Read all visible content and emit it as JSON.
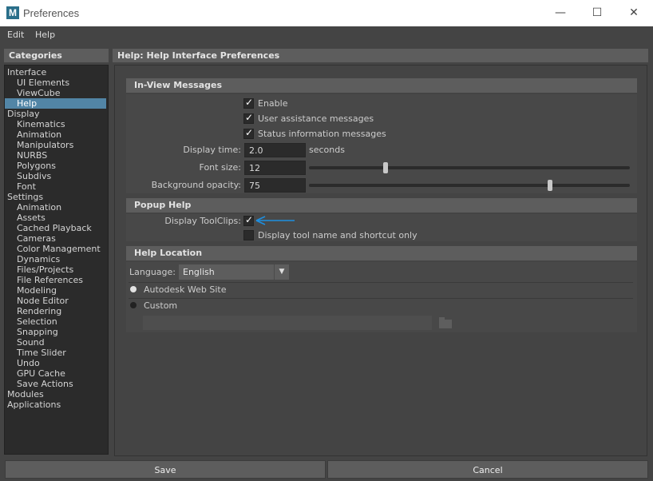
{
  "window": {
    "title": "Preferences",
    "app_icon_letter": "M",
    "minimize_glyph": "—",
    "maximize_glyph": "☐",
    "close_glyph": "✕"
  },
  "menu": {
    "items": [
      "Edit",
      "Help"
    ]
  },
  "categories": {
    "header": "Categories",
    "selected": "Help",
    "items": [
      {
        "label": "Interface",
        "level": 0
      },
      {
        "label": "UI Elements",
        "level": 1
      },
      {
        "label": "ViewCube",
        "level": 1
      },
      {
        "label": "Help",
        "level": 1
      },
      {
        "label": "Display",
        "level": 0
      },
      {
        "label": "Kinematics",
        "level": 1
      },
      {
        "label": "Animation",
        "level": 1
      },
      {
        "label": "Manipulators",
        "level": 1
      },
      {
        "label": "NURBS",
        "level": 1
      },
      {
        "label": "Polygons",
        "level": 1
      },
      {
        "label": "Subdivs",
        "level": 1
      },
      {
        "label": "Font",
        "level": 1
      },
      {
        "label": "Settings",
        "level": 0
      },
      {
        "label": "Animation",
        "level": 1
      },
      {
        "label": "Assets",
        "level": 1
      },
      {
        "label": "Cached Playback",
        "level": 1
      },
      {
        "label": "Cameras",
        "level": 1
      },
      {
        "label": "Color Management",
        "level": 1
      },
      {
        "label": "Dynamics",
        "level": 1
      },
      {
        "label": "Files/Projects",
        "level": 1
      },
      {
        "label": "File References",
        "level": 1
      },
      {
        "label": "Modeling",
        "level": 1
      },
      {
        "label": "Node Editor",
        "level": 1
      },
      {
        "label": "Rendering",
        "level": 1
      },
      {
        "label": "Selection",
        "level": 1
      },
      {
        "label": "Snapping",
        "level": 1
      },
      {
        "label": "Sound",
        "level": 1
      },
      {
        "label": "Time Slider",
        "level": 1
      },
      {
        "label": "Undo",
        "level": 1
      },
      {
        "label": "GPU Cache",
        "level": 1
      },
      {
        "label": "Save Actions",
        "level": 1
      },
      {
        "label": "Modules",
        "level": 0
      },
      {
        "label": "Applications",
        "level": 0
      }
    ]
  },
  "main": {
    "header": "Help: Help Interface Preferences",
    "in_view": {
      "title": "In-View Messages",
      "enable": {
        "label": "Enable",
        "checked": true
      },
      "user_assistance": {
        "label": "User assistance messages",
        "checked": true
      },
      "status_info": {
        "label": "Status information messages",
        "checked": true
      },
      "display_time": {
        "label": "Display time:",
        "value": "2.0",
        "unit": "seconds"
      },
      "font_size": {
        "label": "Font size:",
        "value": "12",
        "slider_fraction": 0.24
      },
      "bg_opacity": {
        "label": "Background opacity:",
        "value": "75",
        "slider_fraction": 0.75
      }
    },
    "popup": {
      "title": "Popup Help",
      "toolclips": {
        "label": "Display ToolClips:",
        "checked": true
      },
      "name_shortcut": {
        "label": "Display tool name and shortcut only",
        "checked": false
      }
    },
    "location": {
      "title": "Help Location",
      "language_label": "Language:",
      "language_value": "English",
      "autodesk": {
        "label": "Autodesk Web Site",
        "selected": true
      },
      "custom": {
        "label": "Custom",
        "selected": false
      },
      "path_value": ""
    }
  },
  "check_glyph": "✓",
  "dropdown_glyph": "▼",
  "buttons": {
    "save": "Save",
    "cancel": "Cancel"
  },
  "colors": {
    "selection": "#5285a6",
    "annotation_arrow": "#1e8fe0"
  }
}
